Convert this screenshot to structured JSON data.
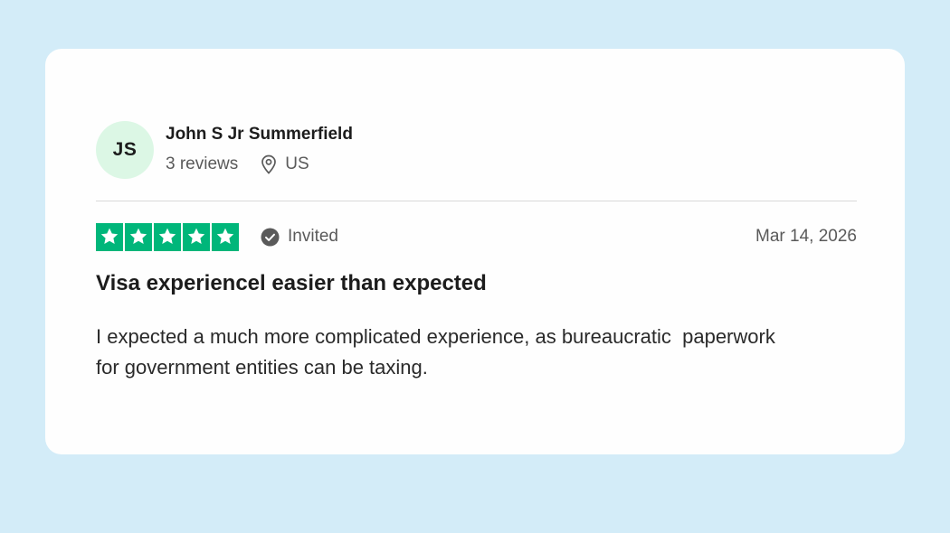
{
  "reviewer": {
    "initials": "JS",
    "name": "John S Jr Summerfield",
    "reviews_count": "3 reviews",
    "location": "US",
    "avatar_color": "#dcf7e5"
  },
  "rating": {
    "stars": 5,
    "max_stars": 5,
    "star_color": "#00b67a",
    "invited_label": "Invited",
    "date": "Mar 14, 2026"
  },
  "review": {
    "title": "Visa experiencel easier than expected",
    "body": "I expected a much more complicated experience, as bureaucratic  paperwork\nfor government entities can be taxing."
  },
  "icons": {
    "location": "map-pin-icon",
    "invited": "check-circle-icon",
    "star": "star-icon"
  },
  "colors": {
    "background": "#d3ecf8",
    "card": "#fefefe"
  }
}
